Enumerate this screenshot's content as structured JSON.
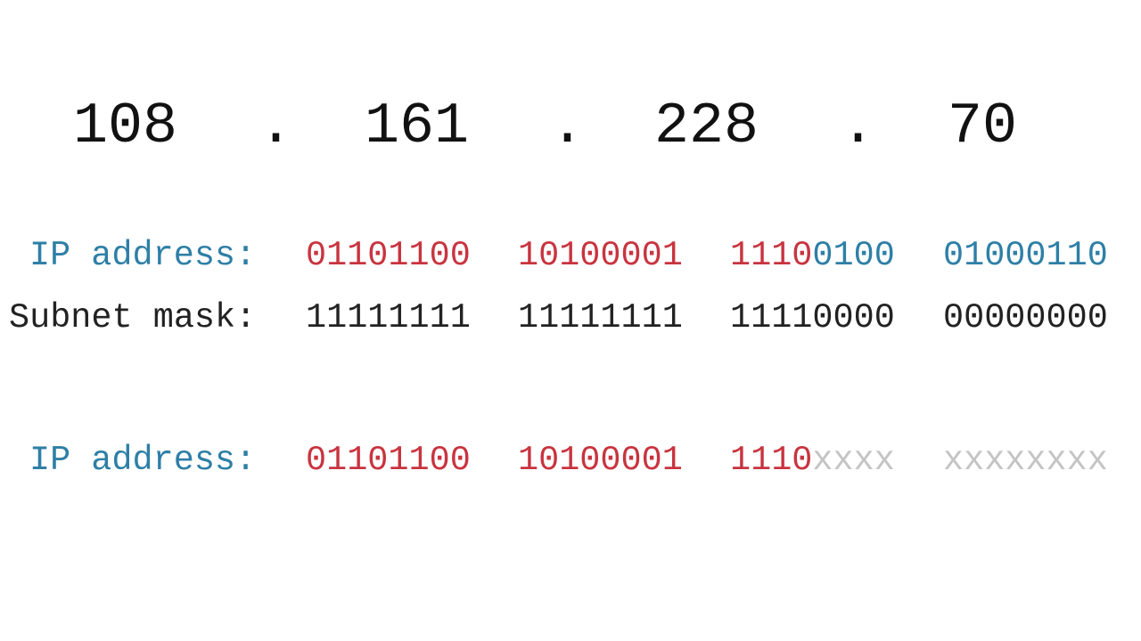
{
  "ip_decimal": {
    "octets": [
      "108",
      "161",
      "228",
      "70"
    ],
    "separator": "."
  },
  "rows": {
    "ip": {
      "label": "IP address:",
      "octets": [
        {
          "network": "01101100",
          "host": ""
        },
        {
          "network": "10100001",
          "host": ""
        },
        {
          "network": "1110",
          "host": "0100"
        },
        {
          "network": "",
          "host": "01000110"
        }
      ]
    },
    "mask": {
      "label": "Subnet mask:",
      "octets": [
        "11111111",
        "11111111",
        "11110000",
        "00000000"
      ]
    },
    "network": {
      "label": "IP address:",
      "octets": [
        {
          "network": "01101100",
          "host": ""
        },
        {
          "network": "10100001",
          "host": ""
        },
        {
          "network": "1110",
          "host": "xxxx"
        },
        {
          "network": "",
          "host": "xxxxxxxx"
        }
      ]
    }
  },
  "colors": {
    "label_blue": "#2e7fa6",
    "network_red": "#c8343f",
    "mask_dark": "#222222",
    "masked_gray": "#c4c4c4"
  }
}
